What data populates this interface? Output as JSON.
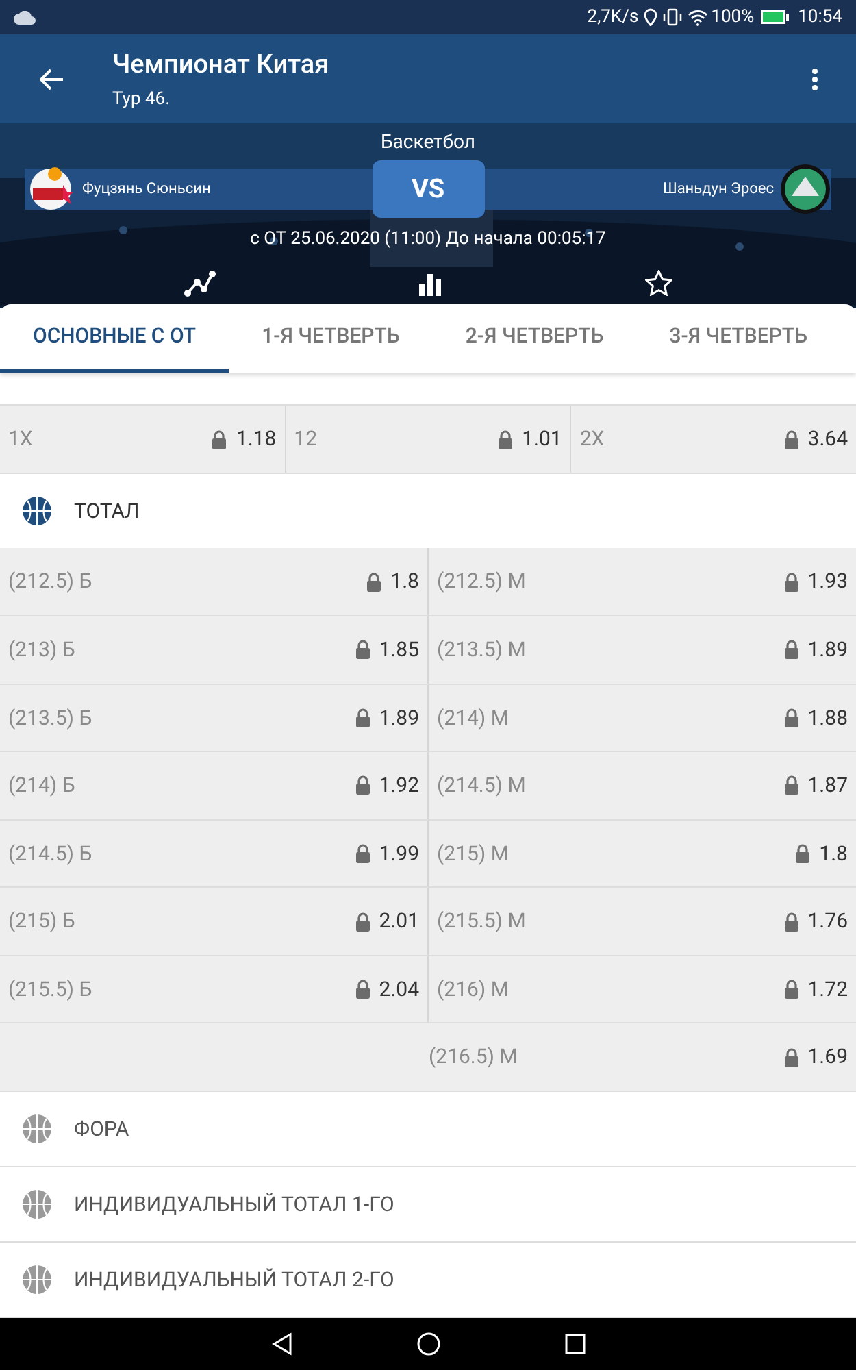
{
  "status_bar": {
    "speed": "2,7K/s",
    "battery": "100%",
    "time": "10:54"
  },
  "app_bar": {
    "title": "Чемпионат Китая",
    "subtitle": "Тур 46."
  },
  "match": {
    "sport": "Баскетбол",
    "home": "Фуцзянь Сюньсин",
    "vs": "VS",
    "away": "Шаньдун Эроес",
    "start": "с ОТ 25.06.2020 (11:00)",
    "countdown": "До начала 00:05:17"
  },
  "tabs": [
    {
      "label": "ОСНОВНЫЕ С ОТ",
      "selected": true
    },
    {
      "label": "1-Я ЧЕТВЕРТЬ",
      "selected": false
    },
    {
      "label": "2-Я ЧЕТВЕРТЬ",
      "selected": false
    },
    {
      "label": "3-Я ЧЕТВЕРТЬ",
      "selected": false
    }
  ],
  "double_chance": [
    {
      "label": "1X",
      "odds": "1.18",
      "locked": true
    },
    {
      "label": "12",
      "odds": "1.01",
      "locked": true
    },
    {
      "label": "2X",
      "odds": "3.64",
      "locked": true
    }
  ],
  "total": {
    "title": "ТОТАЛ",
    "expanded": true,
    "rows": [
      [
        {
          "label": "(212.5) Б",
          "odds": "1.8",
          "locked": true
        },
        {
          "label": "(212.5) М",
          "odds": "1.93",
          "locked": true
        }
      ],
      [
        {
          "label": "(213) Б",
          "odds": "1.85",
          "locked": true
        },
        {
          "label": "(213.5) М",
          "odds": "1.89",
          "locked": true
        }
      ],
      [
        {
          "label": "(213.5) Б",
          "odds": "1.89",
          "locked": true
        },
        {
          "label": "(214) М",
          "odds": "1.88",
          "locked": true
        }
      ],
      [
        {
          "label": "(214) Б",
          "odds": "1.92",
          "locked": true
        },
        {
          "label": "(214.5) М",
          "odds": "1.87",
          "locked": true
        }
      ],
      [
        {
          "label": "(214.5) Б",
          "odds": "1.99",
          "locked": true
        },
        {
          "label": "(215) М",
          "odds": "1.8",
          "locked": true
        }
      ],
      [
        {
          "label": "(215) Б",
          "odds": "2.01",
          "locked": true
        },
        {
          "label": "(215.5) М",
          "odds": "1.76",
          "locked": true
        }
      ],
      [
        {
          "label": "(215.5) Б",
          "odds": "2.04",
          "locked": true
        },
        {
          "label": "(216) М",
          "odds": "1.72",
          "locked": true
        }
      ],
      [
        null,
        {
          "label": "(216.5) М",
          "odds": "1.69",
          "locked": true
        }
      ]
    ]
  },
  "sections": [
    {
      "title": "ФОРА",
      "expanded": false
    },
    {
      "title": "ИНДИВИДУАЛЬНЫЙ ТОТАЛ 1-ГО",
      "expanded": false
    },
    {
      "title": "ИНДИВИДУАЛЬНЫЙ ТОТАЛ 2-ГО",
      "expanded": false
    }
  ]
}
